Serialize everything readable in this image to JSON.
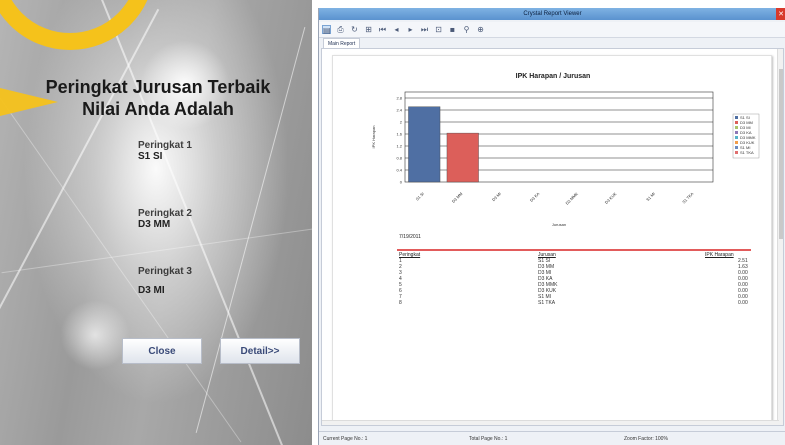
{
  "left": {
    "title_line1": "Peringkat Jurusan Terbaik",
    "title_line2": "Nilai Anda Adalah",
    "ranks": [
      {
        "label": "Peringkat 1",
        "value": "S1 SI"
      },
      {
        "label": "Peringkat 2",
        "value": "D3 MM"
      },
      {
        "label": "Peringkat 3",
        "value": "D3 MI"
      }
    ],
    "close_label": "Close",
    "detail_label": "Detail>>"
  },
  "viewer": {
    "title": "Crystal Report Viewer",
    "close_glyph": "✕",
    "tab_label": "Main Report",
    "toolbar_icons": [
      {
        "name": "export-icon",
        "glyph": "▤"
      },
      {
        "name": "print-icon",
        "glyph": "⎙"
      },
      {
        "name": "refresh-icon",
        "glyph": "↻"
      },
      {
        "name": "group-tree-icon",
        "glyph": "⊞"
      },
      {
        "name": "first-page-icon",
        "glyph": "⏮"
      },
      {
        "name": "prev-page-icon",
        "glyph": "◂"
      },
      {
        "name": "next-page-icon",
        "glyph": "▸"
      },
      {
        "name": "last-page-icon",
        "glyph": "⏭"
      },
      {
        "name": "goto-page-icon",
        "glyph": "⊡"
      },
      {
        "name": "stop-icon",
        "glyph": "▪"
      },
      {
        "name": "search-icon",
        "glyph": "⚲"
      },
      {
        "name": "zoom-icon",
        "glyph": "⊕"
      }
    ],
    "status": {
      "current_page": "Current Page No.: 1",
      "total_pages": "Total Page No.: 1",
      "zoom": "Zoom Factor: 100%"
    }
  },
  "report": {
    "section_label": "7/19/2011",
    "columns": [
      "Peringkat",
      "Jurusan",
      "IPK Harapan"
    ],
    "rows": [
      {
        "rank": "1",
        "major": "S1 SI",
        "value": "2.51"
      },
      {
        "rank": "2",
        "major": "D3 MM",
        "value": "1.63"
      },
      {
        "rank": "3",
        "major": "D3 MI",
        "value": "0.00"
      },
      {
        "rank": "4",
        "major": "D3 KA",
        "value": "0.00"
      },
      {
        "rank": "5",
        "major": "D3 MMK",
        "value": "0.00"
      },
      {
        "rank": "6",
        "major": "D3 KUK",
        "value": "0.00"
      },
      {
        "rank": "7",
        "major": "S1 MI",
        "value": "0.00"
      },
      {
        "rank": "8",
        "major": "S1 TKA",
        "value": "0.00"
      }
    ]
  },
  "chart_data": {
    "type": "bar",
    "title": "IPK Harapan / Jurusan",
    "ylabel": "IPK Harapan",
    "xlabel": "Jurusan",
    "categories": [
      "S1 SI",
      "D3 MM",
      "D3 MI",
      "D3 KA",
      "D3 MMK",
      "D3 KUK",
      "S1 MI",
      "S1 TKA"
    ],
    "values": [
      2.51,
      1.63,
      0,
      0,
      0,
      0,
      0,
      0
    ],
    "bar_colors": [
      "#4f6fa3",
      "#dc5f5a",
      "#a9c46a",
      "#8f77b4",
      "#57b3c9",
      "#f29d4a",
      "#6b8bc1",
      "#e06f6f"
    ],
    "ylim": [
      0,
      3
    ],
    "yticks": [
      "0",
      "0.4",
      "0.8",
      "1.2",
      "1.6",
      "2",
      "2.4",
      "2.8"
    ],
    "ytick_values": [
      0,
      0.4,
      0.8,
      1.2,
      1.6,
      2,
      2.4,
      2.8
    ],
    "grid": true,
    "legend_position": "right",
    "legend": [
      "S1 SI",
      "D3 MM",
      "D3 MI",
      "D3 KA",
      "D3 MMK",
      "D3 KUK",
      "S1 MI",
      "S1 TKA"
    ]
  }
}
